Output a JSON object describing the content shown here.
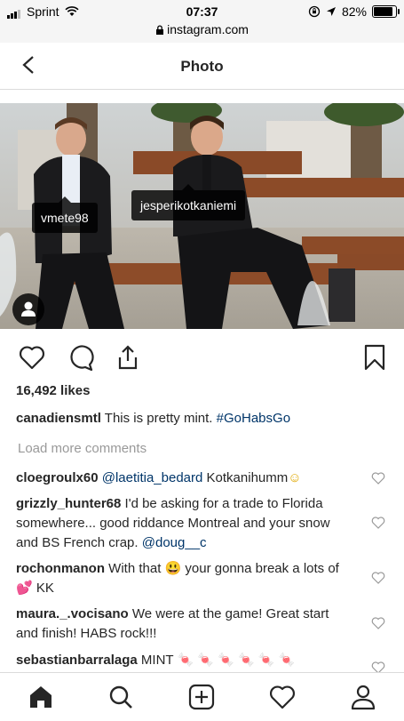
{
  "status_bar": {
    "carrier": "Sprint",
    "time": "07:37",
    "battery": "82%",
    "url": "instagram.com"
  },
  "header": {
    "title": "Photo"
  },
  "post": {
    "photo_tags": [
      "vmete98",
      "jesperikotkaniemi"
    ],
    "likes": "16,492 likes",
    "caption_user": "canadiensmtl",
    "caption_text": "This is pretty mint.",
    "caption_hashtag": "#GoHabsGo",
    "load_more": "Load more comments"
  },
  "comments": [
    {
      "user": "cloegroulx60",
      "mention": "@laetitia_bedard",
      "text": "Kotkanihumm",
      "emoji": "☺"
    },
    {
      "user": "grizzly_hunter68",
      "text": "I'd be asking for a trade to Florida somewhere... good riddance Montreal and your snow and BS French crap.",
      "mention": "@doug__c"
    },
    {
      "user": "rochonmanon",
      "text_a": "With that",
      "emoji_a": "😃",
      "text_b": "your gonna break a lots of",
      "emoji_b": "💕",
      "text_c": "KK"
    },
    {
      "user": "maura._.vocisano",
      "text": "We were at the game! Great start and finish! HABS rock!!!"
    },
    {
      "user": "sebastianbarralaga",
      "text": "MINT",
      "emoji": "🍬 🍬 🍬 🍬 🍬 🍬"
    }
  ],
  "tabs": [
    "home-icon",
    "search-icon",
    "new-post-icon",
    "activity-heart-icon",
    "profile-icon"
  ],
  "colors": {
    "link": "#003569",
    "muted": "#999999",
    "divider": "#dbdbdb"
  }
}
